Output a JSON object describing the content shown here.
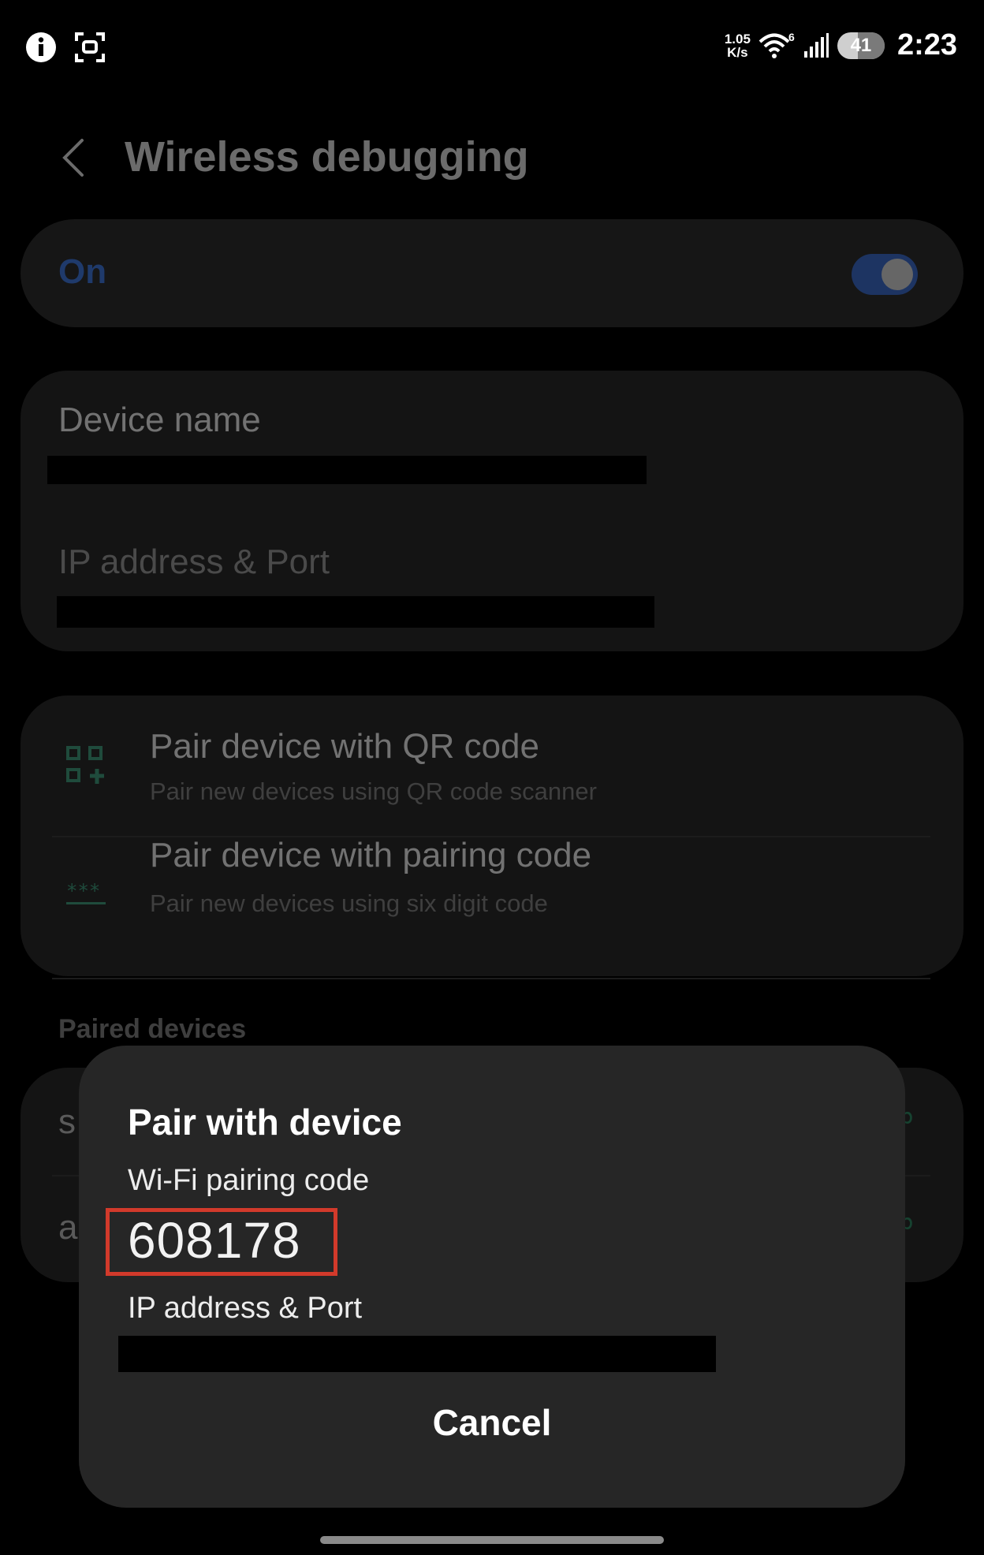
{
  "status_bar": {
    "net_speed_value": "1.05",
    "net_speed_unit": "K/s",
    "wifi_badge": "6",
    "battery": "41",
    "time": "2:23"
  },
  "header": {
    "title": "Wireless debugging"
  },
  "toggle": {
    "label": "On",
    "state": true,
    "accent": "#1d3462"
  },
  "info": {
    "device_name_label": "Device name",
    "ip_port_label": "IP address & Port"
  },
  "pairing_options": [
    {
      "title": "Pair device with QR code",
      "subtitle": "Pair new devices using QR code scanner",
      "icon": "qr-code-icon"
    },
    {
      "title": "Pair device with pairing code",
      "subtitle": "Pair new devices using six digit code",
      "icon": "pairing-code-icon"
    }
  ],
  "paired_devices": {
    "header": "Paired devices",
    "items": [
      {
        "label_visible": "s"
      },
      {
        "label_visible": "a"
      }
    ]
  },
  "dialog": {
    "title": "Pair with device",
    "code_label": "Wi-Fi pairing code",
    "code": "608178",
    "ip_label": "IP address & Port",
    "cancel_label": "Cancel",
    "highlight_color": "#d23a2b"
  }
}
